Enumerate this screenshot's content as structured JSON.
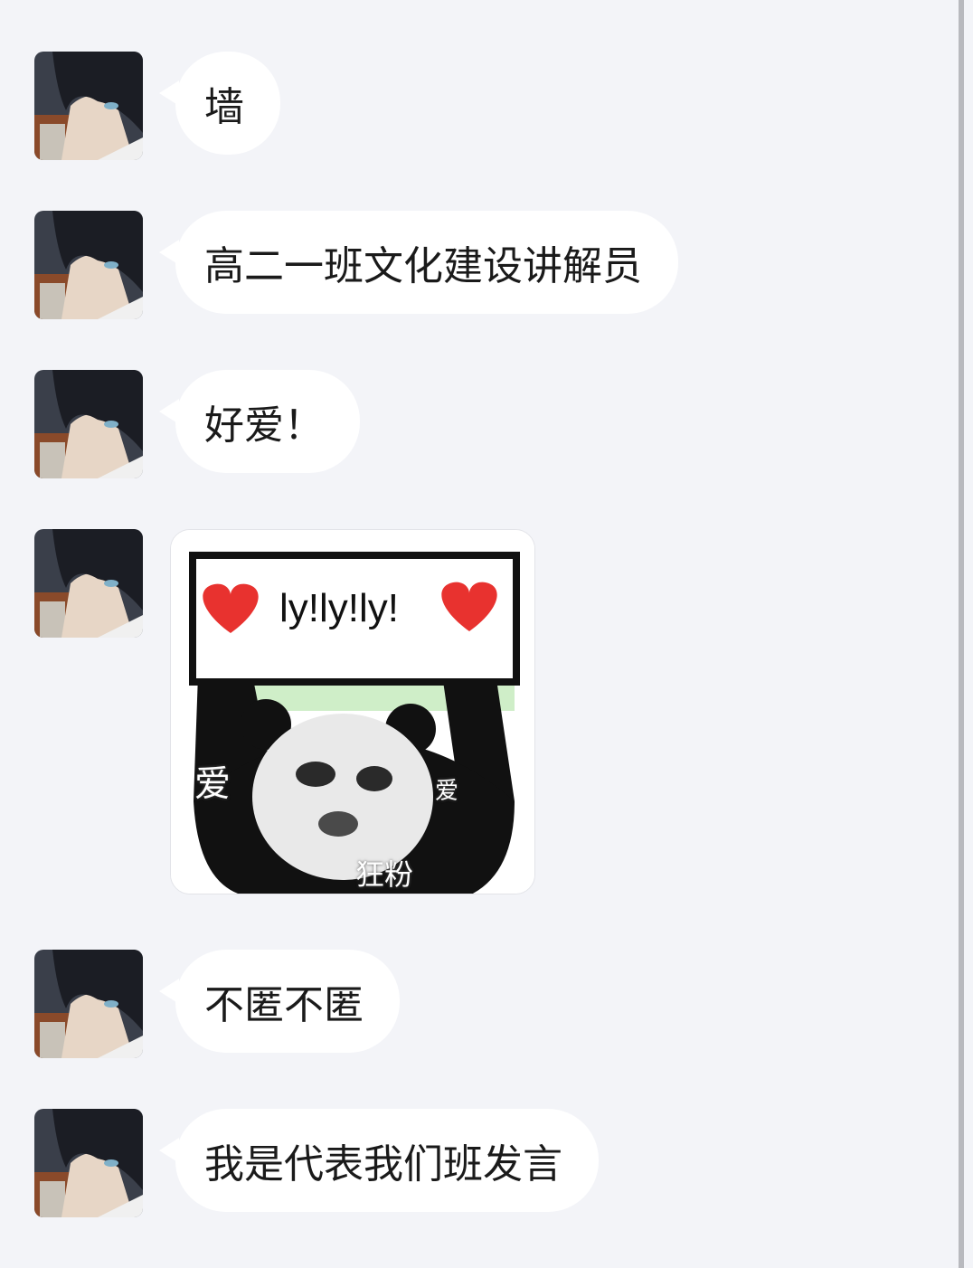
{
  "messages": [
    {
      "type": "text",
      "text": "墙"
    },
    {
      "type": "text",
      "text": "高二一班文化建设讲解员"
    },
    {
      "type": "text",
      "text": "好爱！"
    },
    {
      "type": "sticker",
      "sign_text": "ly!ly!ly!",
      "left_word": "爱",
      "right_word": "爱",
      "bottom_word": "狂粉"
    },
    {
      "type": "text",
      "text": "不匿不匿"
    },
    {
      "type": "text",
      "text": "我是代表我们班发言"
    }
  ],
  "colors": {
    "background": "#f3f4f8",
    "bubble": "#ffffff",
    "text": "#1a1a1a",
    "heart": "#e8322f"
  },
  "icons": {
    "avatar": "anime-avatar-icon",
    "heart": "heart-icon"
  }
}
